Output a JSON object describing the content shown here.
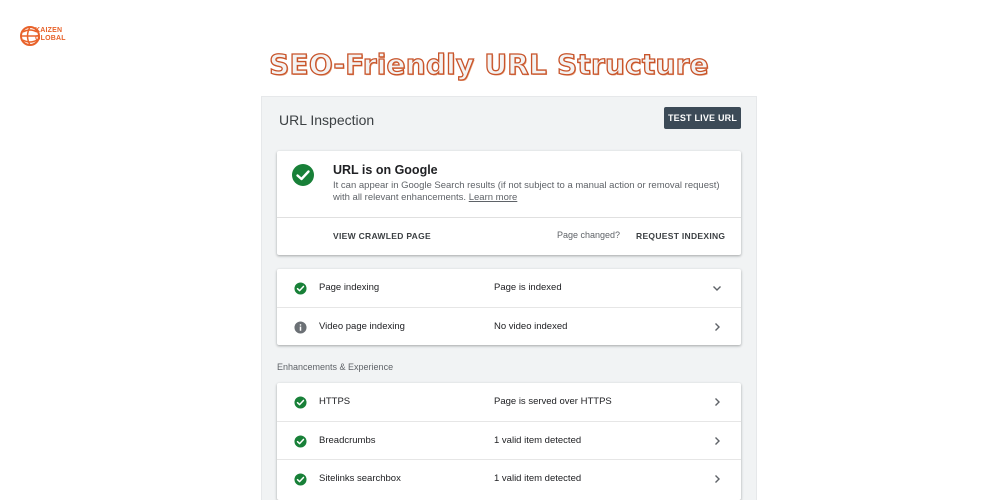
{
  "brand": {
    "logo_line1": "KAIZEN",
    "logo_line2": "GLOBAL",
    "accent": "#e8622a"
  },
  "headline": "SEO-Friendly URL Structure",
  "inspection": {
    "title": "URL Inspection",
    "test_live_label": "TEST LIVE URL",
    "status": {
      "title": "URL is on Google",
      "description": "It can appear in Google Search results (if not subject to a manual action or removal request) with all relevant enhancements.",
      "learn_more": "Learn more",
      "icon": "check-circle-icon",
      "color": "#188038"
    },
    "actions": {
      "view_crawled": "VIEW CRAWLED PAGE",
      "page_changed": "Page changed?",
      "request_indexing": "REQUEST INDEXING"
    },
    "index_rows": [
      {
        "name": "Page indexing",
        "value": "Page is indexed",
        "icon": "check-circle-icon",
        "chevron": "chevron-down-icon"
      },
      {
        "name": "Video page indexing",
        "value": "No video indexed",
        "icon": "info-circle-icon",
        "chevron": "chevron-right-icon"
      }
    ],
    "section_label": "Enhancements & Experience",
    "enhancement_rows": [
      {
        "name": "HTTPS",
        "value": "Page is served over HTTPS",
        "icon": "check-circle-icon",
        "chevron": "chevron-right-icon"
      },
      {
        "name": "Breadcrumbs",
        "value": "1 valid item detected",
        "icon": "check-circle-icon",
        "chevron": "chevron-right-icon"
      },
      {
        "name": "Sitelinks searchbox",
        "value": "1 valid item detected",
        "icon": "check-circle-icon",
        "chevron": "chevron-right-icon"
      }
    ]
  }
}
